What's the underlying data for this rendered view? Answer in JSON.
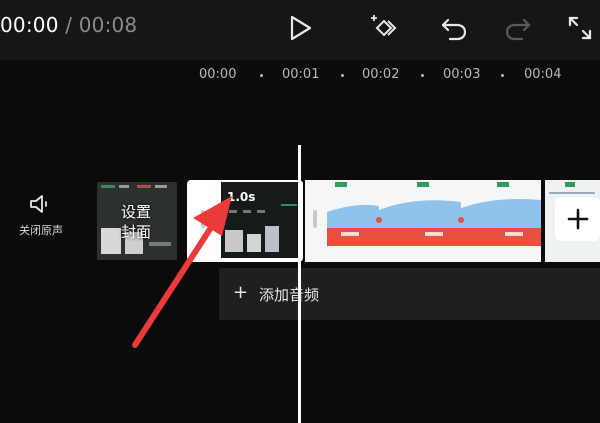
{
  "header": {
    "current_time": "00:00",
    "separator": "/",
    "total_time": "00:08"
  },
  "ruler": {
    "ticks": [
      "00:00",
      "00:01",
      "00:02",
      "00:03",
      "00:04"
    ]
  },
  "track": {
    "mute_label": "关闭原声",
    "cover_label_line1": "设置",
    "cover_label_line2": "封面",
    "clip_duration": "1.0s",
    "add_audio_label": "添加音频"
  },
  "colors": {
    "accent_red": "#ea3a3a",
    "background": "#0b0b0b",
    "topbar": "#161616"
  },
  "icons": [
    "play-icon",
    "keyframe-icon",
    "undo-icon",
    "redo-icon",
    "fullscreen-icon",
    "speaker-icon",
    "plus-icon"
  ]
}
